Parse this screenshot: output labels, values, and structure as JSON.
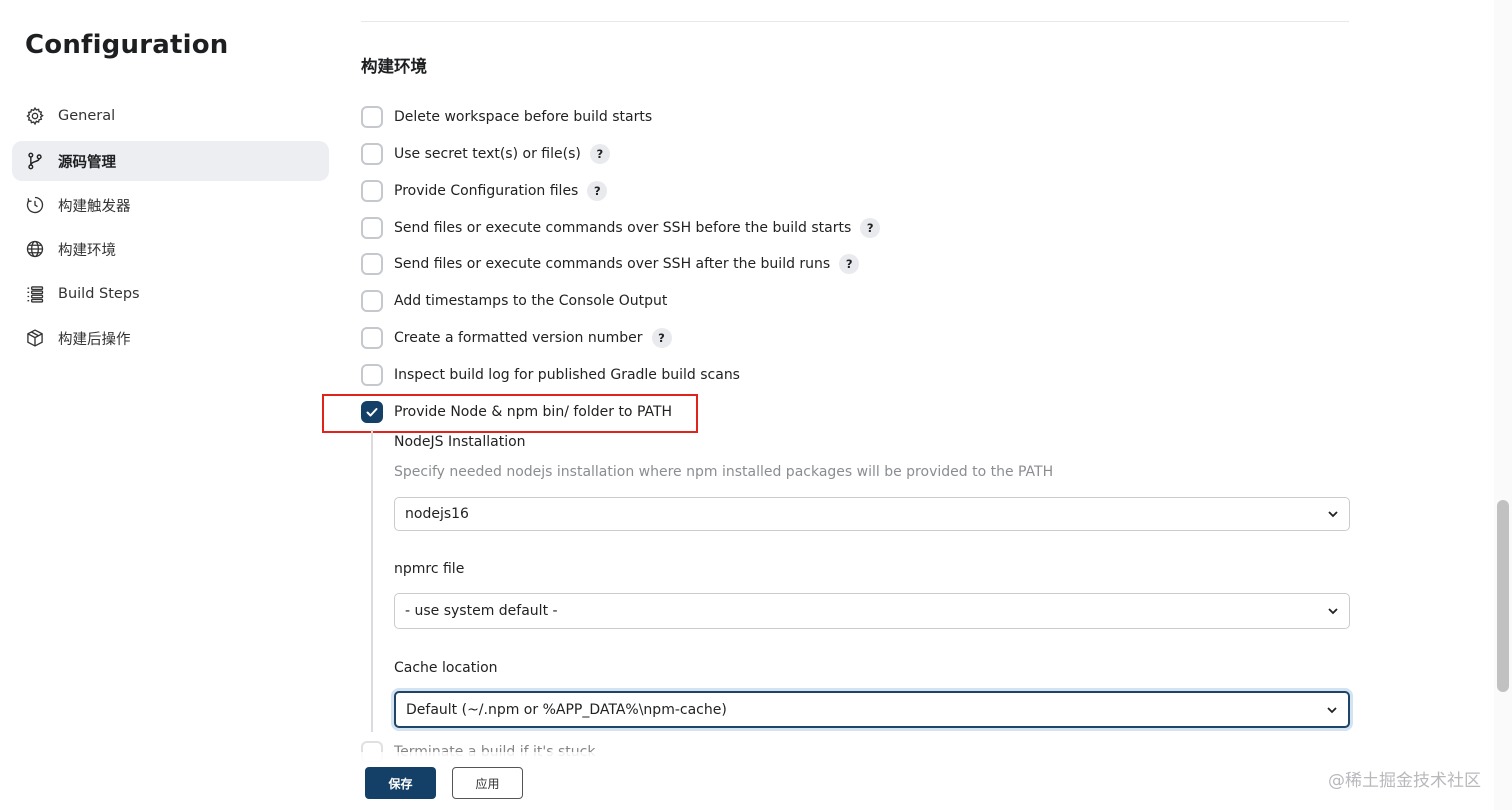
{
  "sidebar": {
    "title": "Configuration",
    "items": [
      {
        "label": "General",
        "icon": "gear-icon"
      },
      {
        "label": "源码管理",
        "icon": "branch-icon"
      },
      {
        "label": "构建触发器",
        "icon": "timer-icon"
      },
      {
        "label": "构建环境",
        "icon": "globe-icon"
      },
      {
        "label": "Build Steps",
        "icon": "list-icon"
      },
      {
        "label": "构建后操作",
        "icon": "cube-icon"
      }
    ],
    "active_index": 1
  },
  "section": {
    "title": "构建环境",
    "options": [
      {
        "label": "Delete workspace before build starts",
        "checked": false,
        "help": false
      },
      {
        "label": "Use secret text(s) or file(s)",
        "checked": false,
        "help": true
      },
      {
        "label": "Provide Configuration files",
        "checked": false,
        "help": true
      },
      {
        "label": "Send files or execute commands over SSH before the build starts",
        "checked": false,
        "help": true
      },
      {
        "label": "Send files or execute commands over SSH after the build runs",
        "checked": false,
        "help": true
      },
      {
        "label": "Add timestamps to the Console Output",
        "checked": false,
        "help": false
      },
      {
        "label": "Create a formatted version number",
        "checked": false,
        "help": true
      },
      {
        "label": "Inspect build log for published Gradle build scans",
        "checked": false,
        "help": false
      },
      {
        "label": "Provide Node & npm bin/ folder to PATH",
        "checked": true,
        "help": false
      }
    ],
    "help_glyph": "?",
    "node": {
      "installation_label": "NodeJS Installation",
      "installation_desc": "Specify needed nodejs installation where npm installed packages will be provided to the PATH",
      "installation_value": "nodejs16",
      "npmrc_label": "npmrc file",
      "npmrc_value": "- use system default -",
      "cache_label": "Cache location",
      "cache_value": "Default (~/.npm or %APP_DATA%\\npm-cache)"
    },
    "faded_option": "Terminate a build if it's stuck"
  },
  "buttons": {
    "save": "保存",
    "apply": "应用"
  },
  "watermark": "@稀土掘金技术社区",
  "colors": {
    "primary": "#143f66",
    "highlight": "#e0241b",
    "active_nav_bg": "#edeef2"
  }
}
